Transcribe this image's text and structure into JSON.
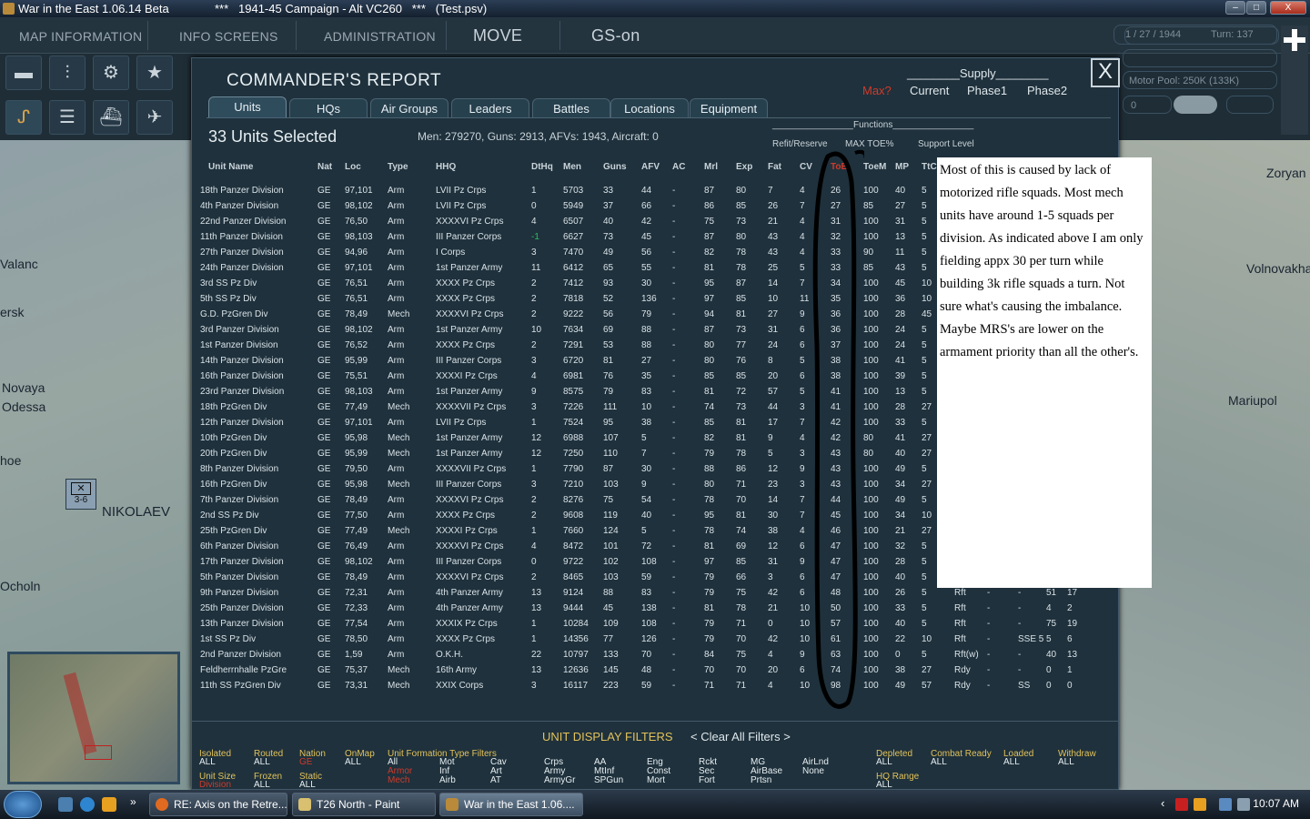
{
  "window": {
    "app_title": "War in the East 1.06.14 Beta",
    "campaign_title": "***   1941-45 Campaign - Alt VC260   ***   (Test.psv)",
    "minimize": "–",
    "maximize": "□",
    "close": "X"
  },
  "topbar": {
    "map_information": "MAP INFORMATION",
    "info_screens": "INFO SCREENS",
    "administration": "ADMINISTRATION",
    "move": "MOVE",
    "gs_on": "GS-on"
  },
  "right_panel": {
    "date": "1 / 27 / 1944",
    "turn": "Turn: 137",
    "motor_pool": "Motor Pool:  250K (133K)",
    "counter": "0"
  },
  "toolbar": {
    "f1": "F1",
    "f2": "F2",
    "f3": "F3",
    "f4": "F4"
  },
  "map_labels": [
    "Valanc",
    "ersk",
    "Novaya",
    "Odessa",
    "hoe",
    "NIKOLAEV",
    "Ocholn",
    "Zoryan",
    "Volnovakha",
    "Mariupol"
  ],
  "unit_counter": "3-6",
  "report": {
    "title": "COMMANDER'S REPORT",
    "close": "X",
    "supply_header": "________Supply________",
    "supply_options": [
      "Max?",
      "Current",
      "Phase1",
      "Phase2"
    ],
    "tabs": [
      "Units",
      "HQs",
      "Air Groups",
      "Leaders",
      "Battles",
      "Locations",
      "Equipment"
    ],
    "active_tab": "Units",
    "selected": "33 Units Selected",
    "summary": "Men: 279270, Guns: 2913, AFVs: 1943, Aircraft: 0",
    "functions_header": "________________Functions________________",
    "functions": [
      "Refit/Reserve",
      "MAX TOE%",
      "Support Level"
    ],
    "columns": [
      "Unit Name",
      "Nat",
      "Loc",
      "Type",
      "HHQ",
      "DtHq",
      "Men",
      "Guns",
      "AFV",
      "AC",
      "Mrl",
      "Exp",
      "Fat",
      "CV",
      "ToE",
      "ToeM",
      "MP",
      "TtC"
    ],
    "rows": [
      [
        "18th Panzer Division",
        "GE",
        "97,101",
        "Arm",
        "LVII Pz Crps",
        "1",
        "5703",
        "33",
        "44",
        "-",
        "87",
        "80",
        "7",
        "4",
        "26",
        "100",
        "40",
        "5"
      ],
      [
        "4th Panzer Division",
        "GE",
        "98,102",
        "Arm",
        "LVII Pz Crps",
        "0",
        "5949",
        "37",
        "66",
        "-",
        "86",
        "85",
        "26",
        "7",
        "27",
        "85",
        "27",
        "5"
      ],
      [
        "22nd Panzer Division",
        "GE",
        "76,50",
        "Arm",
        "XXXXVI Pz Crps",
        "4",
        "6507",
        "40",
        "42",
        "-",
        "75",
        "73",
        "21",
        "4",
        "31",
        "100",
        "31",
        "5"
      ],
      [
        "11th Panzer Division",
        "GE",
        "98,103",
        "Arm",
        "III Panzer Corps",
        "-1",
        "6627",
        "73",
        "45",
        "-",
        "87",
        "80",
        "43",
        "4",
        "32",
        "100",
        "13",
        "5"
      ],
      [
        "27th Panzer Division",
        "GE",
        "94,96",
        "Arm",
        "I Corps",
        "3",
        "7470",
        "49",
        "56",
        "-",
        "82",
        "78",
        "43",
        "4",
        "33",
        "90",
        "11",
        "5"
      ],
      [
        "24th Panzer Division",
        "GE",
        "97,101",
        "Arm",
        "1st Panzer Army",
        "11",
        "6412",
        "65",
        "55",
        "-",
        "81",
        "78",
        "25",
        "5",
        "33",
        "85",
        "43",
        "5"
      ],
      [
        "3rd SS Pz Div",
        "GE",
        "76,51",
        "Arm",
        "XXXX Pz Crps",
        "2",
        "7412",
        "93",
        "30",
        "-",
        "95",
        "87",
        "14",
        "7",
        "34",
        "100",
        "45",
        "10"
      ],
      [
        "5th SS Pz Div",
        "GE",
        "76,51",
        "Arm",
        "XXXX Pz Crps",
        "2",
        "7818",
        "52",
        "136",
        "-",
        "97",
        "85",
        "10",
        "11",
        "35",
        "100",
        "36",
        "10"
      ],
      [
        "G.D. PzGren Div",
        "GE",
        "78,49",
        "Mech",
        "XXXXVI Pz Crps",
        "2",
        "9222",
        "56",
        "79",
        "-",
        "94",
        "81",
        "27",
        "9",
        "36",
        "100",
        "28",
        "45"
      ],
      [
        "3rd Panzer Division",
        "GE",
        "98,102",
        "Arm",
        "1st Panzer Army",
        "10",
        "7634",
        "69",
        "88",
        "-",
        "87",
        "73",
        "31",
        "6",
        "36",
        "100",
        "24",
        "5"
      ],
      [
        "1st Panzer Division",
        "GE",
        "76,52",
        "Arm",
        "XXXX Pz Crps",
        "2",
        "7291",
        "53",
        "88",
        "-",
        "80",
        "77",
        "24",
        "6",
        "37",
        "100",
        "24",
        "5"
      ],
      [
        "14th Panzer Division",
        "GE",
        "95,99",
        "Arm",
        "III Panzer Corps",
        "3",
        "6720",
        "81",
        "27",
        "-",
        "80",
        "76",
        "8",
        "5",
        "38",
        "100",
        "41",
        "5"
      ],
      [
        "16th Panzer Division",
        "GE",
        "75,51",
        "Arm",
        "XXXXI Pz Crps",
        "4",
        "6981",
        "76",
        "35",
        "-",
        "85",
        "85",
        "20",
        "6",
        "38",
        "100",
        "39",
        "5"
      ],
      [
        "23rd Panzer Division",
        "GE",
        "98,103",
        "Arm",
        "1st Panzer Army",
        "9",
        "8575",
        "79",
        "83",
        "-",
        "81",
        "72",
        "57",
        "5",
        "41",
        "100",
        "13",
        "5"
      ],
      [
        "18th PzGren Div",
        "GE",
        "77,49",
        "Mech",
        "XXXXVII Pz Crps",
        "3",
        "7226",
        "111",
        "10",
        "-",
        "74",
        "73",
        "44",
        "3",
        "41",
        "100",
        "28",
        "27"
      ],
      [
        "12th Panzer Division",
        "GE",
        "97,101",
        "Arm",
        "LVII Pz Crps",
        "1",
        "7524",
        "95",
        "38",
        "-",
        "85",
        "81",
        "17",
        "7",
        "42",
        "100",
        "33",
        "5"
      ],
      [
        "10th PzGren Div",
        "GE",
        "95,98",
        "Mech",
        "1st Panzer Army",
        "12",
        "6988",
        "107",
        "5",
        "-",
        "82",
        "81",
        "9",
        "4",
        "42",
        "80",
        "41",
        "27"
      ],
      [
        "20th PzGren Div",
        "GE",
        "95,99",
        "Mech",
        "1st Panzer Army",
        "12",
        "7250",
        "110",
        "7",
        "-",
        "79",
        "78",
        "5",
        "3",
        "43",
        "80",
        "40",
        "27"
      ],
      [
        "8th Panzer Division",
        "GE",
        "79,50",
        "Arm",
        "XXXXVII Pz Crps",
        "1",
        "7790",
        "87",
        "30",
        "-",
        "88",
        "86",
        "12",
        "9",
        "43",
        "100",
        "49",
        "5"
      ],
      [
        "16th PzGren Div",
        "GE",
        "95,98",
        "Mech",
        "III Panzer Corps",
        "3",
        "7210",
        "103",
        "9",
        "-",
        "80",
        "71",
        "23",
        "3",
        "43",
        "100",
        "34",
        "27"
      ],
      [
        "7th Panzer Division",
        "GE",
        "78,49",
        "Arm",
        "XXXXVI Pz Crps",
        "2",
        "8276",
        "75",
        "54",
        "-",
        "78",
        "70",
        "14",
        "7",
        "44",
        "100",
        "49",
        "5"
      ],
      [
        "2nd SS Pz Div",
        "GE",
        "77,50",
        "Arm",
        "XXXX Pz Crps",
        "2",
        "9608",
        "119",
        "40",
        "-",
        "95",
        "81",
        "30",
        "7",
        "45",
        "100",
        "34",
        "10"
      ],
      [
        "25th PzGren Div",
        "GE",
        "77,49",
        "Mech",
        "XXXXI Pz Crps",
        "1",
        "7660",
        "124",
        "5",
        "-",
        "78",
        "74",
        "38",
        "4",
        "46",
        "100",
        "21",
        "27"
      ],
      [
        "6th Panzer Division",
        "GE",
        "76,49",
        "Arm",
        "XXXXVI Pz Crps",
        "4",
        "8472",
        "101",
        "72",
        "-",
        "81",
        "69",
        "12",
        "6",
        "47",
        "100",
        "32",
        "5"
      ],
      [
        "17th Panzer Division",
        "GE",
        "98,102",
        "Arm",
        "III Panzer Corps",
        "0",
        "9722",
        "102",
        "108",
        "-",
        "97",
        "85",
        "31",
        "9",
        "47",
        "100",
        "28",
        "5"
      ],
      [
        "5th Panzer Division",
        "GE",
        "78,49",
        "Arm",
        "XXXXVI Pz Crps",
        "2",
        "8465",
        "103",
        "59",
        "-",
        "79",
        "66",
        "3",
        "6",
        "47",
        "100",
        "40",
        "5"
      ],
      [
        "9th Panzer Division",
        "GE",
        "72,31",
        "Arm",
        "4th Panzer Army",
        "13",
        "9124",
        "88",
        "83",
        "-",
        "79",
        "75",
        "42",
        "6",
        "48",
        "100",
        "26",
        "5",
        "Rft",
        "-",
        "-",
        "51",
        "17"
      ],
      [
        "25th Panzer Division",
        "GE",
        "72,33",
        "Arm",
        "4th Panzer Army",
        "13",
        "9444",
        "45",
        "138",
        "-",
        "81",
        "78",
        "21",
        "10",
        "50",
        "100",
        "33",
        "5",
        "Rft",
        "-",
        "-",
        "4",
        "2"
      ],
      [
        "13th Panzer Division",
        "GE",
        "77,54",
        "Arm",
        "XXXIX Pz Crps",
        "1",
        "10284",
        "109",
        "108",
        "-",
        "79",
        "71",
        "0",
        "10",
        "57",
        "100",
        "40",
        "5",
        "Rft",
        "-",
        "-",
        "75",
        "19"
      ],
      [
        "1st SS Pz Div",
        "GE",
        "78,50",
        "Arm",
        "XXXX Pz Crps",
        "1",
        "14356",
        "77",
        "126",
        "-",
        "79",
        "70",
        "42",
        "10",
        "61",
        "100",
        "22",
        "10",
        "Rft",
        "-",
        "SSE 5",
        "5",
        "6"
      ],
      [
        "2nd Panzer Division",
        "GE",
        "1,59",
        "Arm",
        "O.K.H.",
        "22",
        "10797",
        "133",
        "70",
        "-",
        "84",
        "75",
        "4",
        "9",
        "63",
        "100",
        "0",
        "5",
        "Rft(w)",
        "-",
        "-",
        "40",
        "13"
      ],
      [
        "Feldherrnhalle PzGre",
        "GE",
        "75,37",
        "Mech",
        "16th Army",
        "13",
        "12636",
        "145",
        "48",
        "-",
        "70",
        "70",
        "20",
        "6",
        "74",
        "100",
        "38",
        "27",
        "Rdy",
        "-",
        "-",
        "0",
        "1"
      ],
      [
        "11th SS PzGren Div",
        "GE",
        "73,31",
        "Mech",
        "XXIX Corps",
        "3",
        "16117",
        "223",
        "59",
        "-",
        "71",
        "71",
        "4",
        "10",
        "98",
        "100",
        "49",
        "57",
        "Rdy",
        "-",
        "SS",
        "0",
        "0"
      ]
    ]
  },
  "filters": {
    "title": "UNIT DISPLAY FILTERS",
    "clear": "< Clear All Filters >",
    "groups": [
      {
        "label": "Isolated",
        "values": [
          "ALL"
        ]
      },
      {
        "label": "Routed",
        "values": [
          "ALL"
        ]
      },
      {
        "label": "Nation",
        "values": [
          "GE"
        ],
        "red": true
      },
      {
        "label": "OnMap",
        "values": [
          "ALL"
        ]
      },
      {
        "label": "Unit Size",
        "values": [
          "Division"
        ],
        "red": true
      },
      {
        "label": "Frozen",
        "values": [
          "ALL"
        ]
      },
      {
        "label": "Static",
        "values": [
          "ALL"
        ]
      },
      {
        "label": "Unit  Formation  Type  Filters",
        "values": []
      },
      {
        "label": "Depleted",
        "values": [
          "ALL"
        ]
      },
      {
        "label": "Combat Ready",
        "values": [
          "ALL"
        ]
      },
      {
        "label": "Loaded",
        "values": [
          "ALL"
        ]
      },
      {
        "label": "Withdraw",
        "values": [
          "ALL"
        ]
      },
      {
        "label": "HQ Range",
        "values": [
          "ALL"
        ]
      }
    ],
    "type_cols": [
      [
        "All",
        "Armor",
        "Mech"
      ],
      [
        "Mot",
        "Inf",
        "Airb"
      ],
      [
        "Cav",
        "Art",
        "AT"
      ],
      [
        "Crps",
        "Army",
        "ArmyGr"
      ],
      [
        "AA",
        "MtInf",
        "SPGun"
      ],
      [
        "Eng",
        "Const",
        "Mort"
      ],
      [
        "Rckt",
        "Sec",
        "Fort"
      ],
      [
        "MG",
        "AirBase",
        "Prtsn"
      ],
      [
        "AirLnd",
        "None"
      ]
    ]
  },
  "note": "Most of this is caused by lack of motorized rifle squads. Most mech units have around 1-5 squads per division. As indicated above I am only fielding appx 30 per turn while building 3k rifle squads a turn. Not sure what's causing the imbalance. Maybe MRS's are lower on the armament priority than all the other's.",
  "taskbar": {
    "tasks": [
      "RE: Axis on the Retre...",
      "T26 North - Paint",
      "War in the East 1.06...."
    ],
    "clock": "10:07 AM"
  },
  "colors": {
    "accent": "#e2c25a",
    "alert": "#d03a2a",
    "panel": "#1f313c"
  }
}
